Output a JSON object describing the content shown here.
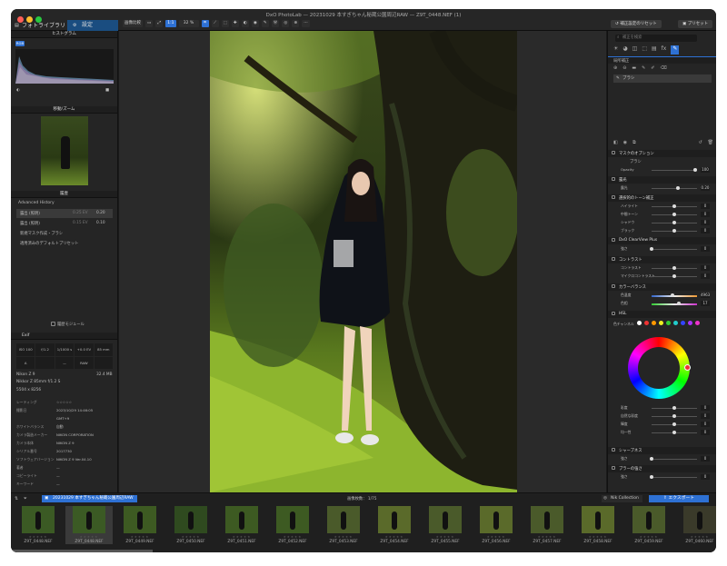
{
  "app": {
    "window_title": "DxO PhotoLab — 20231029 本すぎちゃん秘蔵公園周辺RAW — Z9T_0448.NEF (1)",
    "tab_library": "フォトライブラリ",
    "tab_customize": "設定",
    "reset_button": "補正設定のリセット",
    "preset_button": "プリセット"
  },
  "toolbar": {
    "compare": "画像比較",
    "zoom": "1:1",
    "zoom_pct": "32 %"
  },
  "left": {
    "histogram_title": "ヒストグラム",
    "rgb": "RGB",
    "navigator_title": "移動/ズーム",
    "history_title": "履歴",
    "history_header": "Advanced History",
    "history_items": [
      {
        "label": "露出 (照明)",
        "value": "0.25 EV",
        "value2": "0.20"
      },
      {
        "label": "露出 (照明)",
        "value": "0.15 EV",
        "value2": "0.10"
      },
      {
        "label": "新規マスク作成・ブラシ",
        "value": "",
        "value2": ""
      },
      {
        "label": "適用済みのデフォルトプリセット",
        "value": "",
        "value2": ""
      }
    ],
    "history_footer": "履歴モジュール",
    "exif_title": "Exif",
    "exif_grid": [
      "ISO 100",
      "f/1.2",
      "1/1000 s",
      "+0.0 EV",
      "85 mm",
      "A",
      "",
      "—",
      "RAW",
      ""
    ],
    "camera": "Nikon Z 9",
    "file_size": "32.4 MB",
    "lens": "Nikkor Z 85mm f/1.2 S",
    "dimensions": "5504 x 8256",
    "meta": [
      {
        "k": "レーティング",
        "v": "☆☆☆☆☆"
      },
      {
        "k": "撮影日",
        "v": "2023/10/29 14:46:05"
      },
      {
        "k": "",
        "v": "GMT+9"
      },
      {
        "k": "ホワイトバランス",
        "v": "自動"
      },
      {
        "k": "カメラ製造メーカー",
        "v": "NIKON CORPORATION"
      },
      {
        "k": "カメラ本体",
        "v": "NIKON Z 9"
      },
      {
        "k": "シリアル番号",
        "v": "2017730"
      },
      {
        "k": "ソフトウェアバージョン",
        "v": "NIKON Z 9 Ver.04.10"
      },
      {
        "k": "著者",
        "v": "—"
      },
      {
        "k": "コピーライト",
        "v": "—"
      },
      {
        "k": "キーワード",
        "v": "—"
      }
    ]
  },
  "right": {
    "search_placeholder": "補正を検索",
    "local_adj": "局所補正",
    "brush": "ブラシ",
    "mask_options": "マスクのオプション",
    "brush_sub": "ブラシ",
    "opacity_label": "Opacity",
    "opacity_value": "100",
    "exposure_title": "露光",
    "exposure_label": "露光",
    "exposure_value": "0.20",
    "tone_title": "選択的のトーン補正",
    "tone_rows": [
      {
        "label": "ハイライト",
        "value": "0"
      },
      {
        "label": "中間トーン",
        "value": "0"
      },
      {
        "label": "シャドウ",
        "value": "0"
      },
      {
        "label": "ブラック",
        "value": "0"
      }
    ],
    "clearview_title": "DxO ClearView Plus",
    "clearview_label": "強さ",
    "clearview_value": "0",
    "contrast_title": "コントラスト",
    "contrast_rows": [
      {
        "label": "コントラスト",
        "value": "0"
      },
      {
        "label": "マイクロコントラスト",
        "value": "0"
      }
    ],
    "color_title": "カラーバランス",
    "color_rows": [
      {
        "label": "色温度",
        "value": "4963"
      },
      {
        "label": "色相",
        "value": "17"
      }
    ],
    "hsl_title": "HSL",
    "hsl_channel": "色チャンネル",
    "hsl_rows": [
      {
        "label": "彩度",
        "value": "0"
      },
      {
        "label": "自然な彩度",
        "value": "0"
      },
      {
        "label": "輝度",
        "value": "0"
      },
      {
        "label": "均一性",
        "value": "0"
      }
    ],
    "sharpen_title": "シャープネス",
    "sharpen_label": "強さ",
    "sharpen_value": "0",
    "blur_title": "ブラーの強さ",
    "blur_label": "強さ",
    "blur_value": "0",
    "swatch_colors": [
      "#ffffff",
      "#e33",
      "#f90",
      "#ee2",
      "#3c3",
      "#2cc",
      "#34f",
      "#a3f",
      "#e3c"
    ]
  },
  "film": {
    "folder": "20231029 本すぎちゃん秘蔵公園周辺RAW",
    "count_label": "画像枚数：",
    "count": "1/75",
    "nik": "Nik Collection",
    "export": "エクスポート",
    "thumbs": [
      "Z9T_0448.NEF",
      "Z9T_0448.NEF",
      "Z9T_0449.NEF",
      "Z9T_0450.NEF",
      "Z9T_0451.NEF",
      "Z9T_0452.NEF",
      "Z9T_0453.NEF",
      "Z9T_0454.NEF",
      "Z9T_0455.NEF",
      "Z9T_0456.NEF",
      "Z9T_0457.NEF",
      "Z9T_0458.NEF",
      "Z9T_0459.NEF",
      "Z9T_0460.NEF"
    ]
  }
}
